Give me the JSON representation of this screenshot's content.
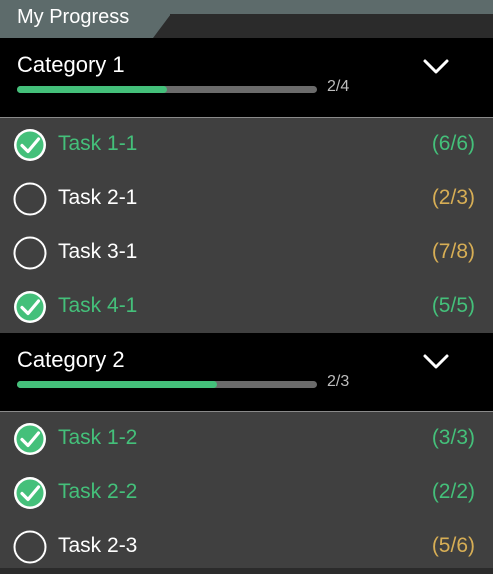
{
  "title": "My Progress",
  "colors": {
    "accent_green": "#44c07a",
    "pending_gold": "#d7ae55",
    "header_bg": "#000000",
    "list_bg": "#404040",
    "tab_bg": "#5d6b6b"
  },
  "categories": [
    {
      "name": "Category 1",
      "progress_text": "2/4",
      "progress_fraction": 0.5,
      "expand_icon": "chevron-down-icon",
      "tasks": [
        {
          "label": "Task 1-1",
          "count": "(6/6)",
          "done": true
        },
        {
          "label": "Task 2-1",
          "count": "(2/3)",
          "done": false
        },
        {
          "label": "Task 3-1",
          "count": "(7/8)",
          "done": false
        },
        {
          "label": "Task 4-1",
          "count": "(5/5)",
          "done": true
        }
      ]
    },
    {
      "name": "Category 2",
      "progress_text": "2/3",
      "progress_fraction": 0.667,
      "expand_icon": "chevron-down-icon",
      "tasks": [
        {
          "label": "Task 1-2",
          "count": "(3/3)",
          "done": true
        },
        {
          "label": "Task 2-2",
          "count": "(2/2)",
          "done": true
        },
        {
          "label": "Task 2-3",
          "count": "(5/6)",
          "done": false
        }
      ]
    }
  ]
}
